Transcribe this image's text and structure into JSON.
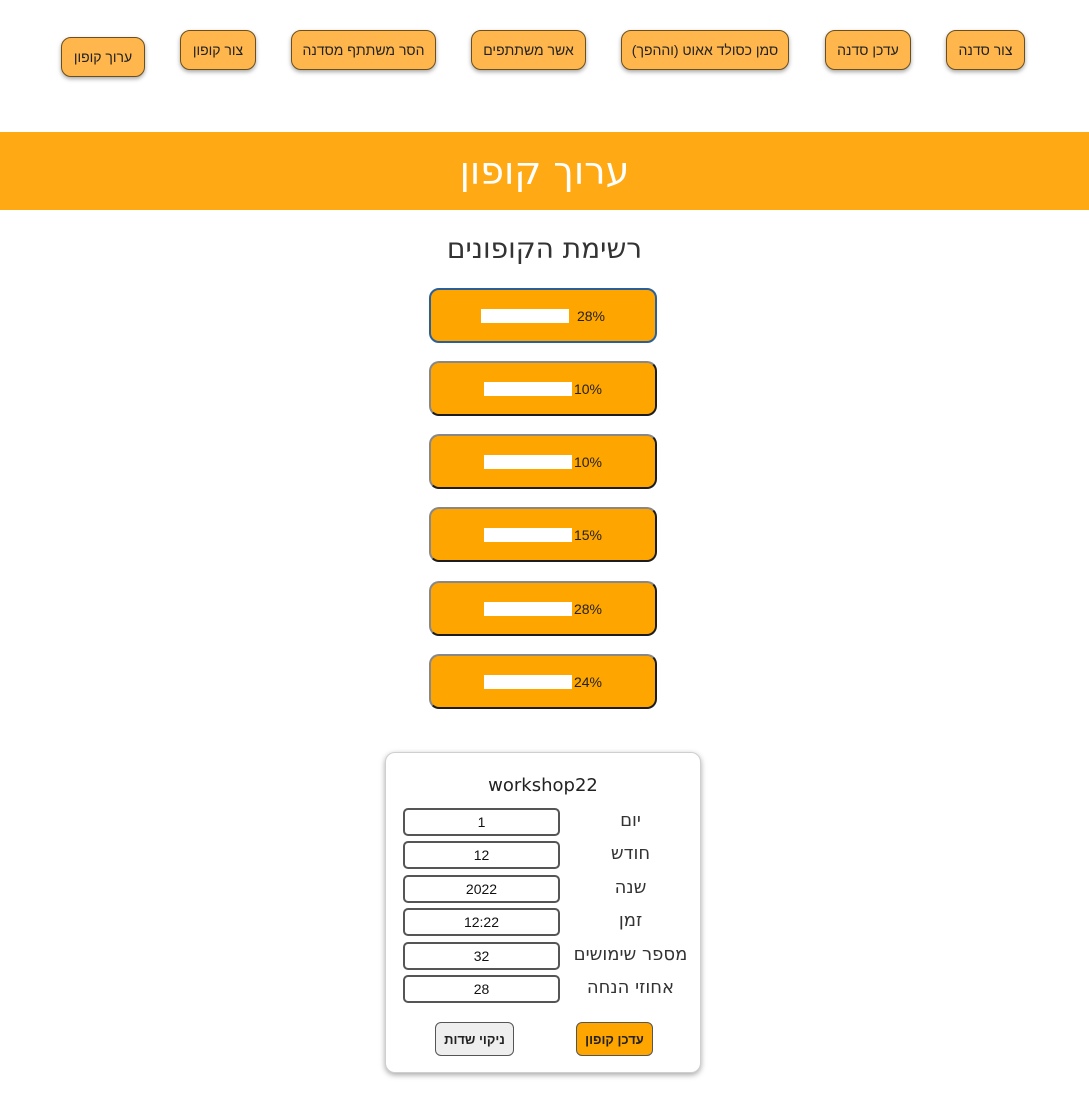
{
  "nav": {
    "items": [
      {
        "label": "צור סדנה"
      },
      {
        "label": "עדכן סדנה"
      },
      {
        "label": "סמן כסולד אאוט (וההפך)"
      },
      {
        "label": "אשר משתתפים"
      },
      {
        "label": "הסר משתתף מסדנה"
      },
      {
        "label": "צור קופון"
      },
      {
        "label": "ערוך קופון"
      }
    ]
  },
  "banner": {
    "title": "ערוך קופון"
  },
  "coupon_list": {
    "title": "רשימת הקופונים",
    "items": [
      {
        "percent": "28%",
        "selected": true
      },
      {
        "percent": "10%"
      },
      {
        "percent": "10%"
      },
      {
        "percent": "15%"
      },
      {
        "percent": "28%"
      },
      {
        "percent": "24%"
      }
    ]
  },
  "edit_form": {
    "title": "workshop22",
    "fields": [
      {
        "label": "יום",
        "value": "1"
      },
      {
        "label": "חודש",
        "value": "12"
      },
      {
        "label": "שנה",
        "value": "2022"
      },
      {
        "label": "זמן",
        "value": "12:22"
      },
      {
        "label": "מספר שימושים",
        "value": "32"
      },
      {
        "label": "אחוזי הנחה",
        "value": "28"
      }
    ],
    "update_label": "עדכן קופון",
    "clear_label": "ניקוי שדות"
  },
  "colors": {
    "accent": "#ffa914",
    "nav_button": "#ffb74d",
    "coupon": "#ffa500",
    "selected_border": "#2a5f9e"
  }
}
